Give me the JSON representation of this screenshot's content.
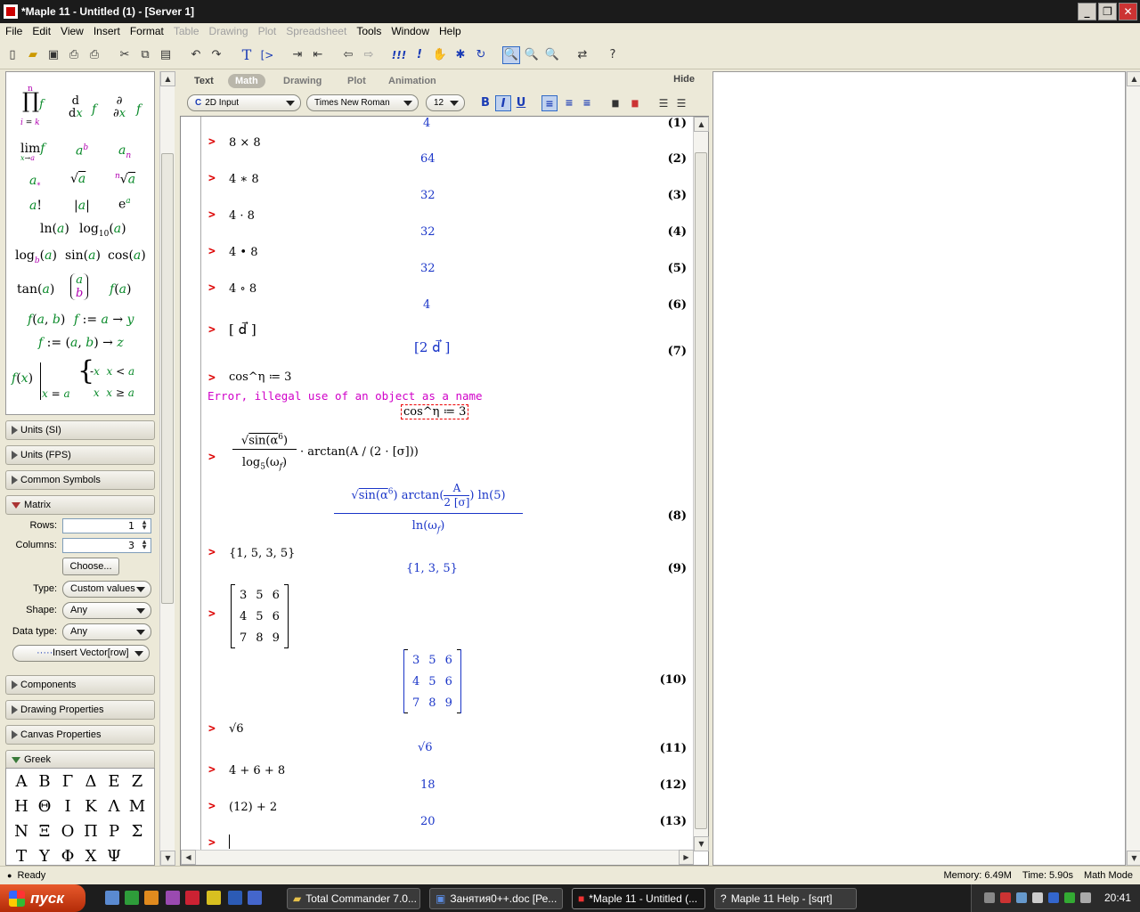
{
  "window": {
    "title": "*Maple 11 - Untitled (1) - [Server 1]"
  },
  "menu": [
    {
      "label": "File",
      "enabled": true
    },
    {
      "label": "Edit",
      "enabled": true
    },
    {
      "label": "View",
      "enabled": true
    },
    {
      "label": "Insert",
      "enabled": true
    },
    {
      "label": "Format",
      "enabled": true
    },
    {
      "label": "Table",
      "enabled": false
    },
    {
      "label": "Drawing",
      "enabled": false
    },
    {
      "label": "Plot",
      "enabled": false
    },
    {
      "label": "Spreadsheet",
      "enabled": false
    },
    {
      "label": "Tools",
      "enabled": true
    },
    {
      "label": "Window",
      "enabled": true
    },
    {
      "label": "Help",
      "enabled": true
    }
  ],
  "toolbar": {
    "icons": [
      "new-icon",
      "open-icon",
      "save-icon",
      "print-icon",
      "print-preview-icon",
      "cut-icon",
      "copy-icon",
      "paste-icon",
      "undo-icon",
      "redo-icon",
      "text-mode-icon",
      "math-input-icon",
      "indent-icon",
      "outdent-icon",
      "back-icon",
      "forward-icon",
      "execute-all-icon",
      "execute-icon",
      "stop-icon",
      "debug-icon",
      "restart-icon",
      "zoom-100-icon",
      "zoom-150-icon",
      "zoom-200-icon",
      "recalc-icon",
      "help-icon"
    ],
    "text_glyph": "T",
    "prompt_glyph": "[>",
    "exec_all_glyph": "!!!",
    "exec_glyph": "!"
  },
  "palettes": {
    "expression": {
      "items": [
        "∏",
        "d/dx f",
        "∂/∂x f",
        "lim f",
        "aᵇ",
        "aₙ",
        "a*",
        "√a",
        "ⁿ√a",
        "a!",
        "|a|",
        "eᵃ",
        "ln(a)",
        "log10(a)",
        "logb(a)",
        "sin(a)",
        "cos(a)",
        "tan(a)",
        "(a b)",
        "f(a)",
        "f(a, b)",
        "f := a → y",
        "f := (a, b) → z",
        "f(x)|x = a",
        "piecewise"
      ]
    },
    "sections": [
      {
        "label": "Units (SI)",
        "open": false
      },
      {
        "label": "Units (FPS)",
        "open": false
      },
      {
        "label": "Common Symbols",
        "open": false
      },
      {
        "label": "Matrix",
        "open": true
      },
      {
        "label": "Components",
        "open": false
      },
      {
        "label": "Drawing Properties",
        "open": false
      },
      {
        "label": "Canvas Properties",
        "open": false
      },
      {
        "label": "Greek",
        "open": true
      }
    ],
    "matrix": {
      "rows_label": "Rows:",
      "rows_value": "1",
      "columns_label": "Columns:",
      "columns_value": "3",
      "choose_label": "Choose...",
      "type_label": "Type:",
      "type_value": "Custom values",
      "shape_label": "Shape:",
      "shape_value": "Any",
      "datatype_label": "Data type:",
      "datatype_value": "Any",
      "insert_label": "Insert Vector[row]"
    },
    "greek": [
      "Α",
      "Β",
      "Γ",
      "Δ",
      "Ε",
      "Ζ",
      "Η",
      "Θ",
      "Ι",
      "Κ",
      "Λ",
      "Μ",
      "Ν",
      "Ξ",
      "Ο",
      "Π",
      "Ρ",
      "Σ",
      "Τ",
      "Υ",
      "Φ",
      "Χ",
      "Ψ"
    ]
  },
  "context_bar": {
    "tabs": [
      "Text",
      "Math",
      "Drawing",
      "Plot",
      "Animation"
    ],
    "active_tab": "Math",
    "hide_label": "Hide",
    "input_mode": "2D Input",
    "font": "Times New Roman",
    "size": "12",
    "bold": "B",
    "italic": "I",
    "underline": "U"
  },
  "worksheet": {
    "prompt": ">",
    "lines": [
      {
        "out": "4",
        "label": "(1)"
      },
      {
        "in": "8 × 8",
        "out": "64",
        "label": "(2)"
      },
      {
        "in": "4 ∗ 8",
        "out": "32",
        "label": "(3)"
      },
      {
        "in": "4 · 8",
        "out": "32",
        "label": "(4)"
      },
      {
        "in": "4 • 8",
        "out": "32",
        "label": "(5)"
      },
      {
        "in": "4 ∘ 8",
        "out": "4",
        "label": "(6)"
      },
      {
        "in": "[ d⃗ ]",
        "out": "[2 d⃗ ]",
        "label": "(7)"
      },
      {
        "in": "cos^η ≔ 3",
        "error": "Error, illegal use of an object as a name",
        "err_expr": "cos^η ≔ 3"
      },
      {
        "in": "√(sin(α^6)) / log5(ωf) · arctan(A / (2·[σ]))",
        "label": "(8)"
      },
      {
        "in": "{1, 5, 3, 5}",
        "out": "{1, 3, 5}",
        "label": "(9)"
      },
      {
        "label": "(10)"
      },
      {
        "in": "√6",
        "out": "√6",
        "label": "(11)"
      },
      {
        "in": "4 + 6 + 8",
        "out": "18",
        "label": "(12)"
      },
      {
        "in": "(12) + 2",
        "out": "20",
        "label": "(13)"
      }
    ],
    "matrix_in": [
      [
        "3",
        "5",
        "6"
      ],
      [
        "4",
        "5",
        "6"
      ],
      [
        "7",
        "8",
        "9"
      ]
    ],
    "matrix_out": [
      [
        "3",
        "5",
        "6"
      ],
      [
        "4",
        "5",
        "6"
      ],
      [
        "7",
        "8",
        "9"
      ]
    ],
    "eq8": {
      "in_num": "sin(α",
      "in_exp": "6",
      "in_den": "log",
      "in_den_sub": "5",
      "in_den_arg": "ω",
      "in_den_argsub": "f",
      "in_tail": "· arctan(A / (2 · [σ]))",
      "out_num": "sin(α",
      "out_exp": "6",
      "out_atan": "arctan",
      "out_A": "A",
      "out_den2": "2 [σ]",
      "out_ln": "ln(5)",
      "out_den": "ln",
      "out_den_arg": "ω",
      "out_den_sub": "f"
    }
  },
  "status": {
    "ready": "Ready",
    "memory": "Memory: 6.49M",
    "time": "Time: 5.90s",
    "mode": "Math Mode"
  },
  "taskbar": {
    "start": "пуск",
    "tasks": [
      "Total Commander 7.0...",
      "Занятия0++.doc [Ре...",
      "*Maple 11 - Untitled (...",
      "Maple 11 Help - [sqrt]"
    ],
    "active_task": 2,
    "clock": "20:41"
  }
}
